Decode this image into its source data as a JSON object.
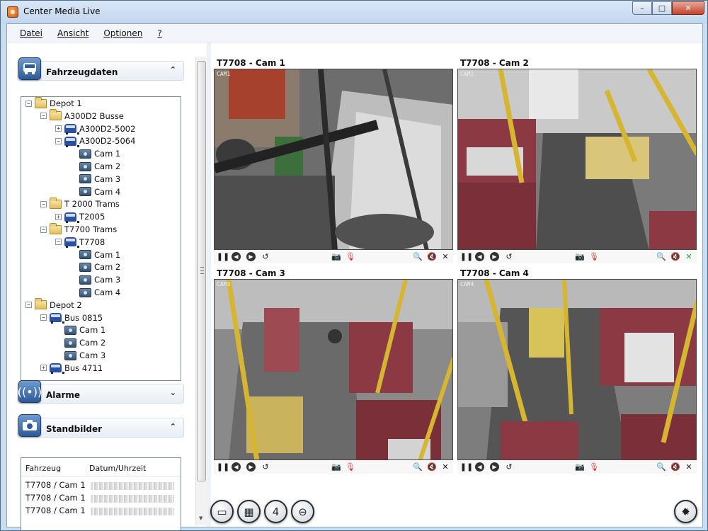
{
  "window": {
    "title": "Center Media Live",
    "min": "–",
    "max": "□",
    "close": "✕"
  },
  "menu": [
    "Datei",
    "Ansicht",
    "Optionen",
    "?"
  ],
  "sections": {
    "vehicle": {
      "title": "Fahrzeugdaten",
      "toggle": "⌃"
    },
    "alarm": {
      "title": "Alarme",
      "toggle": "⌄"
    },
    "stills": {
      "title": "Standbilder",
      "toggle": "⌃"
    }
  },
  "tree": [
    {
      "label": "Depot 1",
      "type": "folder",
      "expander": "−",
      "depth": 0
    },
    {
      "label": "A300D2 Busse",
      "type": "folder",
      "expander": "−",
      "depth": 1
    },
    {
      "label": "A300D2-5002",
      "type": "bus",
      "expander": "+",
      "depth": 2
    },
    {
      "label": "A300D2-5064",
      "type": "bus",
      "expander": "−",
      "depth": 2
    },
    {
      "label": "Cam 1",
      "type": "cam",
      "expander": "",
      "depth": 3
    },
    {
      "label": "Cam 2",
      "type": "cam",
      "expander": "",
      "depth": 3
    },
    {
      "label": "Cam 3",
      "type": "cam",
      "expander": "",
      "depth": 3
    },
    {
      "label": "Cam 4",
      "type": "cam",
      "expander": "",
      "depth": 3
    },
    {
      "label": "T 2000 Trams",
      "type": "folder",
      "expander": "−",
      "depth": 1
    },
    {
      "label": "T2005",
      "type": "bus",
      "expander": "+",
      "depth": 2
    },
    {
      "label": "T7700 Trams",
      "type": "folder",
      "expander": "−",
      "depth": 1
    },
    {
      "label": "T7708",
      "type": "bus",
      "expander": "−",
      "depth": 2
    },
    {
      "label": "Cam 1",
      "type": "cam",
      "expander": "",
      "depth": 3
    },
    {
      "label": "Cam 2",
      "type": "cam",
      "expander": "",
      "depth": 3
    },
    {
      "label": "Cam 3",
      "type": "cam",
      "expander": "",
      "depth": 3
    },
    {
      "label": "Cam 4",
      "type": "cam",
      "expander": "",
      "depth": 3
    },
    {
      "label": "Depot 2",
      "type": "folder",
      "expander": "−",
      "depth": 0
    },
    {
      "label": "Bus 0815",
      "type": "bus",
      "expander": "−",
      "depth": 1
    },
    {
      "label": "Cam 1",
      "type": "cam",
      "expander": "",
      "depth": 2
    },
    {
      "label": "Cam 2",
      "type": "cam",
      "expander": "",
      "depth": 2
    },
    {
      "label": "Cam 3",
      "type": "cam",
      "expander": "",
      "depth": 2
    },
    {
      "label": "Bus 4711",
      "type": "bus",
      "expander": "+",
      "depth": 1
    }
  ],
  "stills_table": {
    "col_vehicle": "Fahrzeug",
    "col_datetime": "Datum/Uhrzeit",
    "rows": [
      "T7708 / Cam 1",
      "T7708 / Cam 1",
      "T7708 / Cam 1"
    ]
  },
  "cameras": [
    {
      "title": "T7708 - Cam 1",
      "label": "CAM1",
      "active": false
    },
    {
      "title": "T7708 - Cam 2",
      "label": "CAM2",
      "active": true
    },
    {
      "title": "T7708 - Cam 3",
      "label": "CAM3",
      "active": false
    },
    {
      "title": "T7708 - Cam 4",
      "label": "CAM4",
      "active": false
    }
  ],
  "controls": {
    "pause": "❚❚",
    "prev": "◀",
    "next": "▶",
    "replay": "↺",
    "snapshot": "📷",
    "record": "🎙",
    "zoom": "🔍",
    "mute": "🔇",
    "close": "✕"
  },
  "layout_buttons": [
    {
      "name": "layout-single-button",
      "glyph": "▭"
    },
    {
      "name": "layout-grid-button",
      "glyph": "▦"
    },
    {
      "name": "layout-four-button",
      "glyph": "4"
    },
    {
      "name": "zoom-out-button",
      "glyph": "⊖"
    }
  ],
  "settings_glyph": "✹"
}
